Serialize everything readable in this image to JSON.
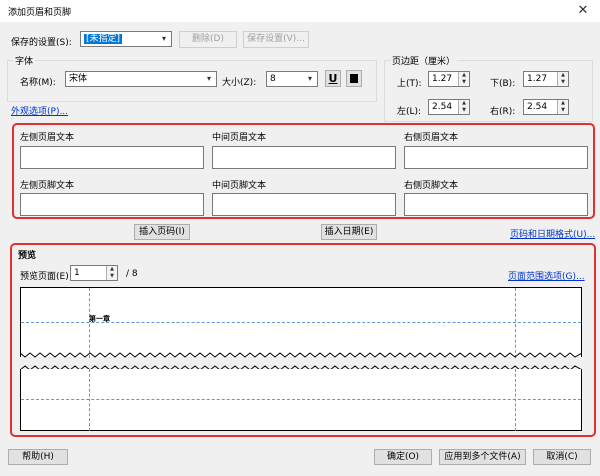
{
  "window": {
    "title": "添加页眉和页脚",
    "close_icon": "✕"
  },
  "top": {
    "saved_settings_label": "保存的设置(S):",
    "saved_settings_value": "[未指定]",
    "delete_label": "删除(D)",
    "save_settings_label": "保存设置(V)..."
  },
  "font": {
    "group_label": "字体",
    "name_label": "名称(M):",
    "name_value": "宋体",
    "size_label": "大小(Z):",
    "size_value": "8",
    "underline_label": "U"
  },
  "margins": {
    "group_label": "页边距（厘米）",
    "top_label": "上(T):",
    "top_value": "1.27",
    "bottom_label": "下(B):",
    "bottom_value": "1.27",
    "left_label": "左(L):",
    "left_value": "2.54",
    "right_label": "右(R):",
    "right_value": "2.54"
  },
  "appearance_link": "外观选项(P)...",
  "header_footer": {
    "left_header": "左侧页眉文本",
    "center_header": "中间页眉文本",
    "right_header": "右侧页眉文本",
    "left_footer": "左侧页脚文本",
    "center_footer": "中间页脚文本",
    "right_footer": "右侧页脚文本"
  },
  "insert_page_label": "插入页码(I)",
  "insert_date_label": "插入日期(E)",
  "format_link": "页码和日期格式(U)...",
  "preview": {
    "group_label": "预览",
    "page_label": "预览页面(E)",
    "page_value": "1",
    "page_total": "/ 8",
    "range_link": "页面范围选项(G)...",
    "sample_text": "第一章"
  },
  "bottom": {
    "help_label": "帮助(H)",
    "ok_label": "确定(O)",
    "apply_multi_label": "应用到多个文件(A)",
    "cancel_label": "取消(C)"
  },
  "colors": {
    "highlight": "#e03030",
    "selection": "#0078d7",
    "link": "#0033cc",
    "guide": "#5b9bd5"
  }
}
